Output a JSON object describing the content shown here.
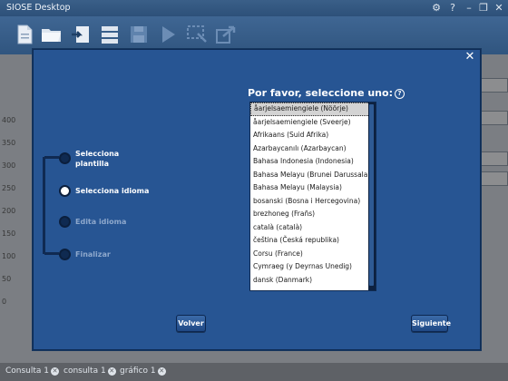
{
  "app": {
    "title": "SIOSE Desktop",
    "window_controls": [
      "gear-icon",
      "help-icon",
      "minimize-icon",
      "restore-icon",
      "close-icon"
    ]
  },
  "toolbar": {
    "buttons": [
      "new-document-icon",
      "open-folder-icon",
      "import-icon",
      "database-icon",
      "save-icon",
      "run-icon",
      "select-area-icon",
      "export-icon"
    ]
  },
  "background": {
    "axis_ticks": [
      "400",
      "350",
      "300",
      "250",
      "200",
      "150",
      "100",
      "50",
      "0"
    ]
  },
  "tabs": [
    {
      "label": "Consulta 1"
    },
    {
      "label": "consulta 1"
    },
    {
      "label": "gráfico 1"
    }
  ],
  "dialog": {
    "steps": [
      {
        "label": "Selecciona plantilla",
        "state": "done"
      },
      {
        "label": "Selecciona idioma",
        "state": "active"
      },
      {
        "label": "Edita idioma",
        "state": "pending"
      },
      {
        "label": "Finalizar",
        "state": "pending"
      }
    ],
    "prompt": "Por favor, seleccione uno:",
    "languages": [
      "åarjelsaemiengiele (Nöörje)",
      "åarjelsaemiengiele (Sveerje)",
      "Afrikaans (Suid Afrika)",
      "Azarbaycanılı (Azarbaycan)",
      "Bahasa Indonesia (Indonesia)",
      "Bahasa Melayu (Brunei Darussalam)",
      "Bahasa Melayu (Malaysia)",
      "bosanski (Bosna i Hercegovina)",
      "brezhoneg (Frañs)",
      "català (català)",
      "čeština (Česká republika)",
      "Corsu (France)",
      "Cymraeg (y Deyrnas Unedig)",
      "dansk (Danmark)"
    ],
    "selected_index": 0,
    "back_label": "Volver",
    "next_label": "Siguiente"
  },
  "colors": {
    "dialog_bg": "#275593",
    "titlebar": "#2d5079",
    "toolbar": "#30557f"
  }
}
